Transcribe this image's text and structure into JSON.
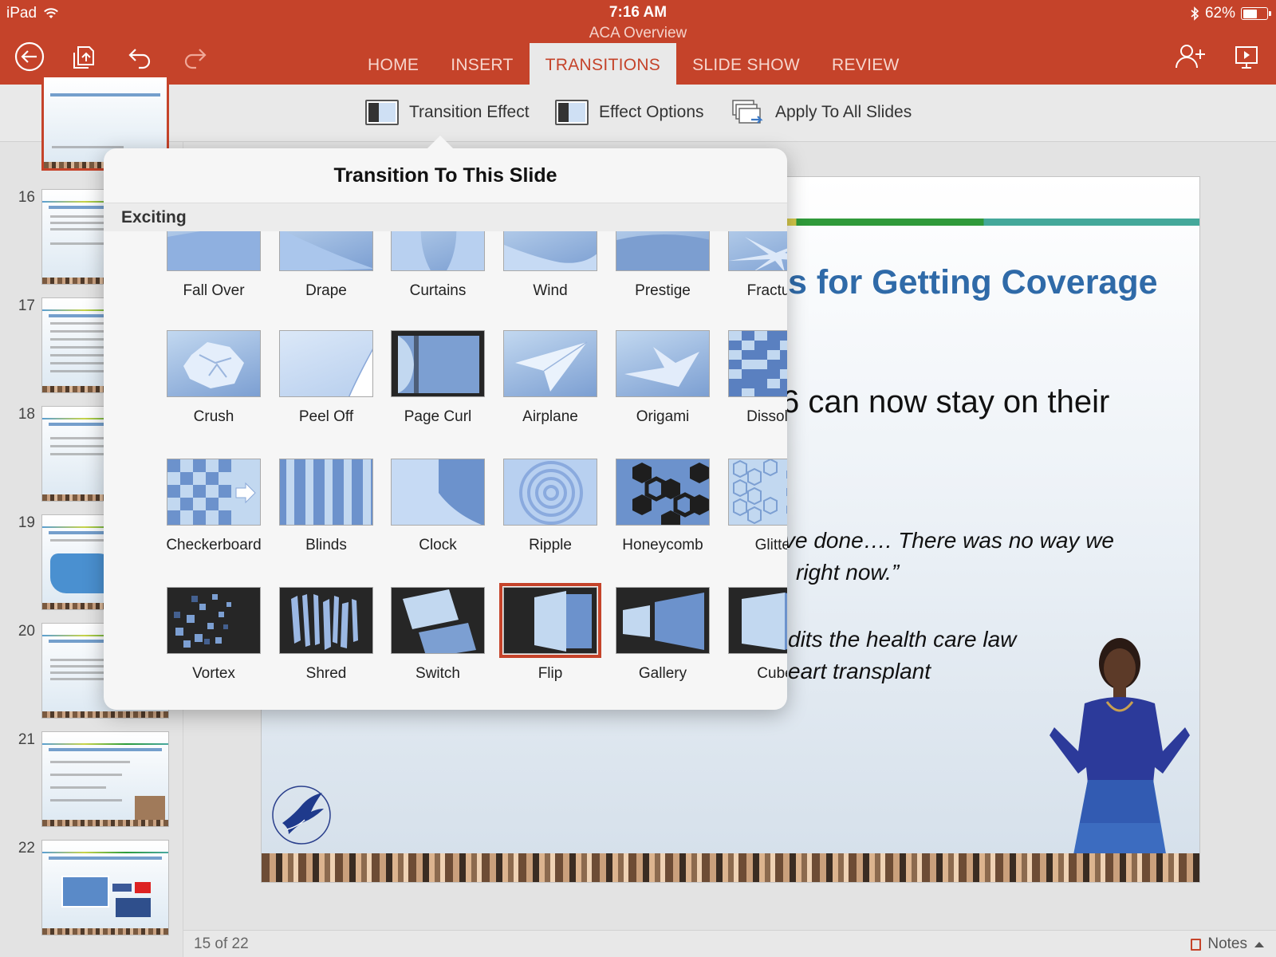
{
  "status": {
    "device": "iPad",
    "time": "7:16 AM",
    "battery": "62%",
    "battery_level": 0.62
  },
  "document": {
    "title": "ACA Overview"
  },
  "tabs": [
    {
      "label": "HOME"
    },
    {
      "label": "INSERT"
    },
    {
      "label": "TRANSITIONS",
      "active": true
    },
    {
      "label": "SLIDE SHOW"
    },
    {
      "label": "REVIEW"
    }
  ],
  "ribbon": {
    "transition_effect": "Transition Effect",
    "effect_options": "Effect Options",
    "apply_all": "Apply To All Slides"
  },
  "thumbnails": [
    {
      "number": "16"
    },
    {
      "number": "17"
    },
    {
      "number": "18"
    },
    {
      "number": "19"
    },
    {
      "number": "20"
    },
    {
      "number": "21"
    },
    {
      "number": "22"
    }
  ],
  "slide": {
    "title": "s for Getting Coverage",
    "line1": "6 can now stay on their",
    "quote1": "ve done…. There was no way we",
    "quote2": "right now.”",
    "quote3": "dits the health care law",
    "quote4": "eart transplant"
  },
  "footer": {
    "slide_count": "15 of 22",
    "notes": "Notes"
  },
  "popover": {
    "title": "Transition To This Slide",
    "section": "Exciting",
    "selected": "Flip",
    "items": [
      {
        "label": "Fall Over"
      },
      {
        "label": "Drape"
      },
      {
        "label": "Curtains"
      },
      {
        "label": "Wind"
      },
      {
        "label": "Prestige"
      },
      {
        "label": "Fracture"
      },
      {
        "label": "Crush"
      },
      {
        "label": "Peel Off"
      },
      {
        "label": "Page Curl"
      },
      {
        "label": "Airplane"
      },
      {
        "label": "Origami"
      },
      {
        "label": "Dissolve"
      },
      {
        "label": "Checkerboard"
      },
      {
        "label": "Blinds"
      },
      {
        "label": "Clock"
      },
      {
        "label": "Ripple"
      },
      {
        "label": "Honeycomb"
      },
      {
        "label": "Glitter"
      },
      {
        "label": "Vortex"
      },
      {
        "label": "Shred"
      },
      {
        "label": "Switch"
      },
      {
        "label": "Flip"
      },
      {
        "label": "Gallery"
      },
      {
        "label": "Cube"
      }
    ]
  },
  "colors": {
    "accent": "#c5432a",
    "tile_light": "#c2d8f0",
    "tile_mid": "#7c9fd2",
    "tile_dark": "#262626"
  }
}
